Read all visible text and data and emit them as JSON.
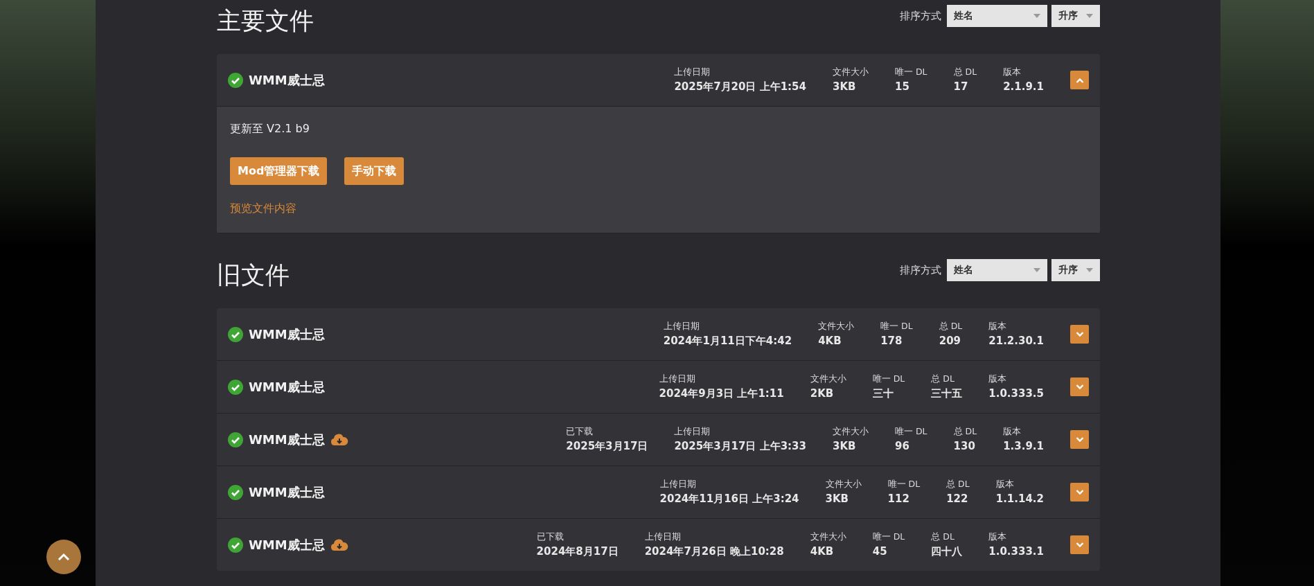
{
  "sections": [
    {
      "title": "主要文件",
      "sort": {
        "label": "排序方式",
        "field": "姓名",
        "order": "升序"
      },
      "files": [
        {
          "name": "WMM威士忌",
          "verified": true,
          "downloaded": false,
          "expanded": true,
          "meta": [
            {
              "label": "上传日期",
              "value": "2025年7月20日 上午1:54"
            },
            {
              "label": "文件大小",
              "value": "3KB"
            },
            {
              "label": "唯一 DL",
              "value": "15"
            },
            {
              "label": "总 DL",
              "value": "17"
            },
            {
              "label": "版本",
              "value": "2.1.9.1"
            }
          ],
          "description": "更新至 V2.1 b9",
          "buttons": [
            "Mod管理器下载",
            "手动下载"
          ],
          "link": "预览文件内容"
        }
      ]
    },
    {
      "title": "旧文件",
      "sort": {
        "label": "排序方式",
        "field": "姓名",
        "order": "升序"
      },
      "files": [
        {
          "name": "WMM威士忌",
          "verified": true,
          "downloaded": false,
          "expanded": false,
          "meta": [
            {
              "label": "上传日期",
              "value": "2024年1月11日下午4:42"
            },
            {
              "label": "文件大小",
              "value": "4KB"
            },
            {
              "label": "唯一 DL",
              "value": "178"
            },
            {
              "label": "总 DL",
              "value": "209"
            },
            {
              "label": "版本",
              "value": "21.2.30.1"
            }
          ]
        },
        {
          "name": "WMM威士忌",
          "verified": true,
          "downloaded": false,
          "expanded": false,
          "meta": [
            {
              "label": "上传日期",
              "value": "2024年9月3日 上午1:11"
            },
            {
              "label": "文件大小",
              "value": "2KB"
            },
            {
              "label": "唯一 DL",
              "value": "三十"
            },
            {
              "label": "总 DL",
              "value": "三十五"
            },
            {
              "label": "版本",
              "value": "1.0.333.5"
            }
          ]
        },
        {
          "name": "WMM威士忌",
          "verified": true,
          "downloaded": true,
          "expanded": false,
          "meta": [
            {
              "label": "已下载",
              "value": "2025年3月17日"
            },
            {
              "label": "上传日期",
              "value": "2025年3月17日 上午3:33"
            },
            {
              "label": "文件大小",
              "value": "3KB"
            },
            {
              "label": "唯一 DL",
              "value": "96"
            },
            {
              "label": "总 DL",
              "value": "130"
            },
            {
              "label": "版本",
              "value": "1.3.9.1"
            }
          ]
        },
        {
          "name": "WMM威士忌",
          "verified": true,
          "downloaded": false,
          "expanded": false,
          "meta": [
            {
              "label": "上传日期",
              "value": "2024年11月16日 上午3:24"
            },
            {
              "label": "文件大小",
              "value": "3KB"
            },
            {
              "label": "唯一 DL",
              "value": "112"
            },
            {
              "label": "总 DL",
              "value": "122"
            },
            {
              "label": "版本",
              "value": "1.1.14.2"
            }
          ]
        },
        {
          "name": "WMM威士忌",
          "verified": true,
          "downloaded": true,
          "expanded": false,
          "meta": [
            {
              "label": "已下载",
              "value": "2024年8月17日"
            },
            {
              "label": "上传日期",
              "value": "2024年7月26日 晚上10:28"
            },
            {
              "label": "文件大小",
              "value": "4KB"
            },
            {
              "label": "唯一 DL",
              "value": "45"
            },
            {
              "label": "总 DL",
              "value": "四十八"
            },
            {
              "label": "版本",
              "value": "1.0.333.1"
            }
          ]
        }
      ]
    }
  ]
}
